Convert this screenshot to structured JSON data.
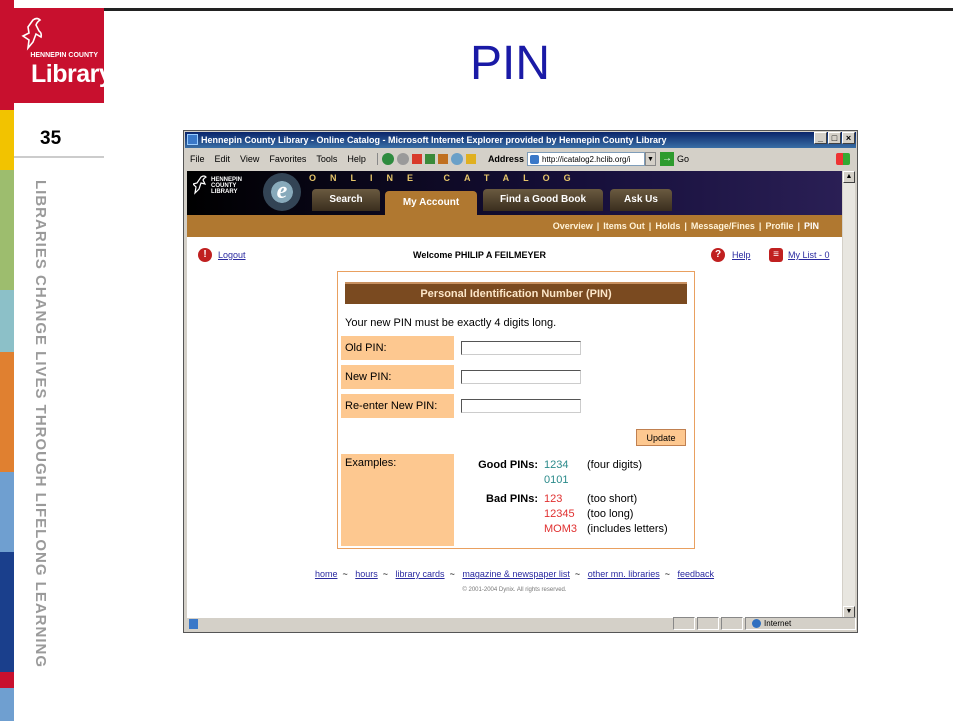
{
  "slide": {
    "title": "PIN",
    "number": "35",
    "tagline": "LIBRARIES CHANGE LIVES THROUGH LIFELONG LEARNING",
    "logo_word": "Library",
    "logo_sub": "HENNEPIN COUNTY",
    "rail_colors": [
      "#c8102e",
      "#f2c300",
      "#9dbd6e",
      "#8cc0c8",
      "#e08030",
      "#6f9fd0",
      "#1a3f8c",
      "#c8102e",
      "#6f9fd0"
    ]
  },
  "browser": {
    "title": "Hennepin County Library - Online Catalog - Microsoft Internet Explorer provided by Hennepin County Library",
    "menu": [
      "File",
      "Edit",
      "View",
      "Favorites",
      "Tools",
      "Help"
    ],
    "address_label": "Address",
    "address_value": "http://icatalog2.hclib.org/i",
    "go_label": "Go",
    "status_zone": "Internet"
  },
  "site": {
    "logo_lines": [
      "HENNEPIN",
      "COUNTY",
      "LIBRARY"
    ],
    "brand_letter": "e",
    "online_catalog": "ONLINE CATALOG",
    "tabs": [
      "Search",
      "My Account",
      "Find a Good Book",
      "Ask Us"
    ],
    "active_tab": "My Account",
    "subnav": [
      "Overview",
      "Items Out",
      "Holds",
      "Message/Fines",
      "Profile",
      "PIN"
    ],
    "logout": "Logout",
    "welcome": "Welcome PHILIP A FEILMEYER",
    "help": "Help",
    "my_list": "My List - 0"
  },
  "pin_form": {
    "heading": "Personal Identification Number (PIN)",
    "description": "Your new PIN must be exactly 4 digits long.",
    "old_pin_label": "Old PIN:",
    "new_pin_label": "New PIN:",
    "reenter_label": "Re-enter New PIN:",
    "old_pin_value": "",
    "new_pin_value": "",
    "reenter_value": "",
    "update_button": "Update",
    "examples_label": "Examples:",
    "good_label": "Good PINs:",
    "good": [
      {
        "pin": "1234",
        "note": "(four digits)"
      },
      {
        "pin": "0101",
        "note": ""
      }
    ],
    "bad_label": "Bad PINs:",
    "bad": [
      {
        "pin": "123",
        "note": "(too short)"
      },
      {
        "pin": "12345",
        "note": "(too long)"
      },
      {
        "pin": "MOM3",
        "note": "(includes letters)"
      }
    ]
  },
  "footer": {
    "links": [
      "home",
      "hours",
      "library cards",
      "magazine & newspaper list",
      "other mn. libraries",
      "feedback"
    ],
    "copyright": "© 2001-2004 Dynix. All rights reserved."
  }
}
